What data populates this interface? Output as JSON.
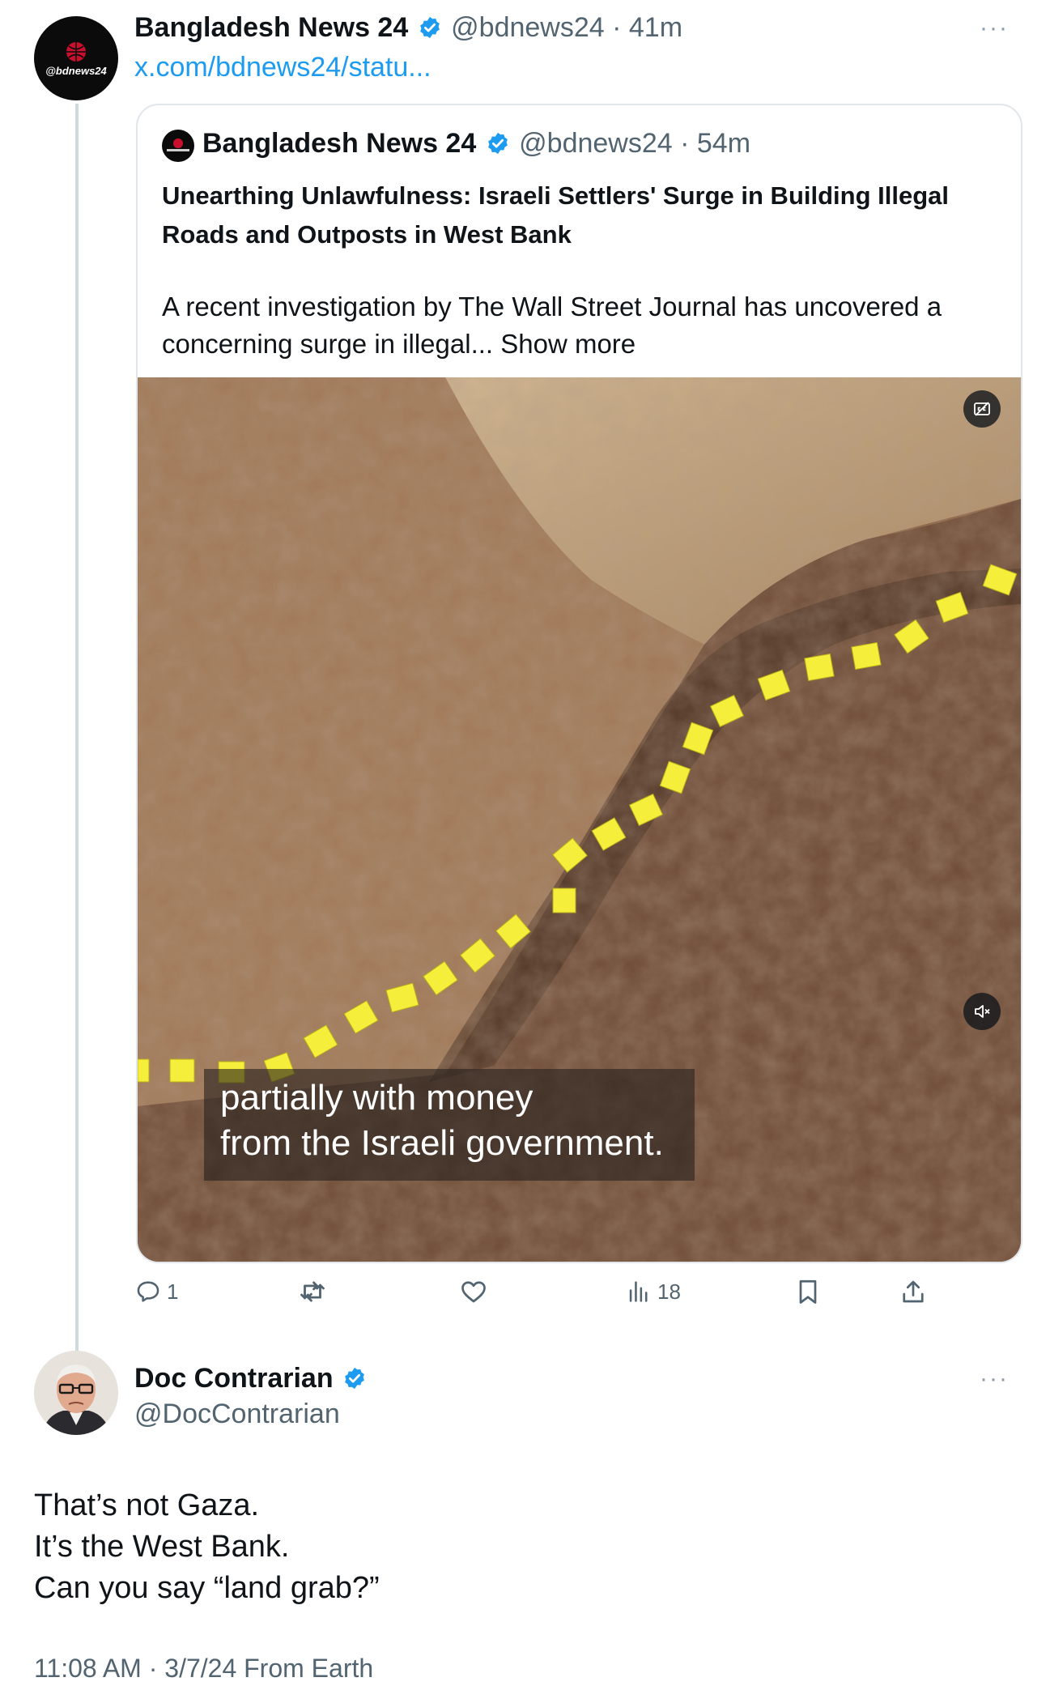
{
  "retweet": {
    "author_name": "Bangladesh News 24",
    "handle_time": "@bdnews24 · 41m",
    "avatar_text": "@bdnews24",
    "link": "x.com/bdnews24/statu...",
    "more": "···"
  },
  "quoted": {
    "author_name": "Bangladesh News 24",
    "handle_time": "@bdnews24 · 54m",
    "avatar_text": "@bdnews24",
    "headline_line1": "Unearthing Unlawfulness: Israeli Settlers' Surge in Building Illegal",
    "headline_line2": "Roads and Outposts in West Bank",
    "body_line1": "A recent investigation by The Wall Street Journal has uncovered a",
    "body_line2_prefix": "concerning surge in illegal...",
    "show_more": "Show more",
    "video": {
      "caption_line1": "partially with money",
      "caption_line2": "from the Israeli government.",
      "cc_icon": "captions-icon",
      "mute_icon": "muted-speaker-icon"
    }
  },
  "actions": {
    "replies": "1",
    "views": "18"
  },
  "reply": {
    "author_name": "Doc Contrarian",
    "handle": "@DocContrarian",
    "more": "···",
    "text_line1": "That’s not Gaza.",
    "text_line2": "It’s the West Bank.",
    "text_line3": "Can you say “land grab?”",
    "timestamp": "11:08 AM · 3/7/24 From Earth"
  },
  "colors": {
    "verified": "#1d9bf0",
    "link": "#1d9bf0",
    "muted": "#536471",
    "route": "#f5ee3a"
  }
}
